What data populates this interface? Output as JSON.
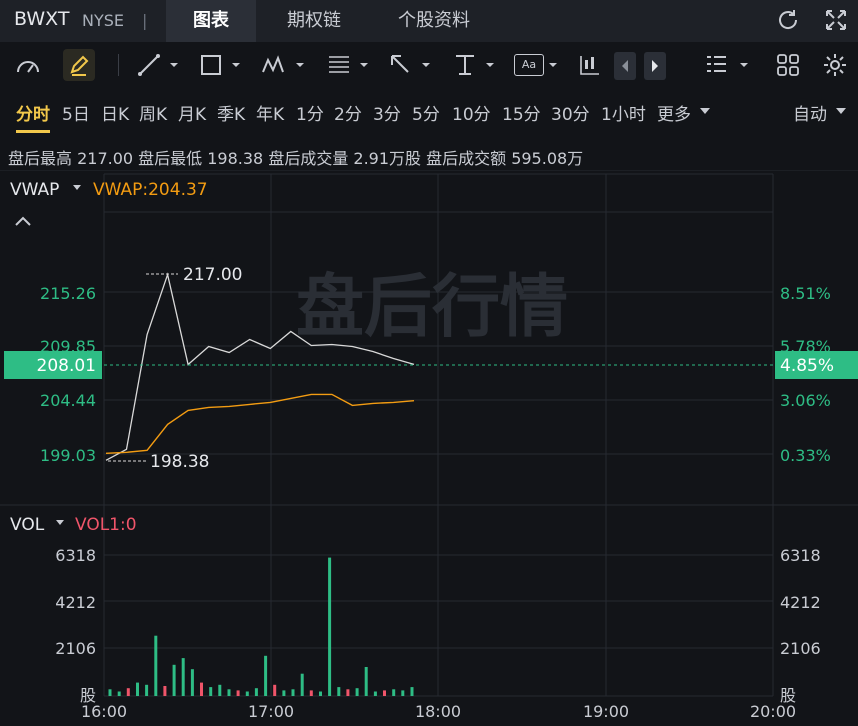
{
  "header": {
    "ticker": "BWXT",
    "exchange": "NYSE",
    "separator": "|",
    "tabs": [
      {
        "label": "图表",
        "active": true
      },
      {
        "label": "期权链",
        "active": false
      },
      {
        "label": "个股资料",
        "active": false
      }
    ],
    "icons": [
      "refresh-icon",
      "fullscreen-icon"
    ]
  },
  "toolbar": {
    "icons": [
      "gauge-icon",
      "pen-icon",
      "line-tool-icon",
      "rectangle-tool-icon",
      "pattern-tool-icon",
      "fibonacci-tool-icon",
      "arrow-tool-icon",
      "price-range-icon",
      "text-annotation-icon",
      "candlestick-icon",
      "prev-arrow-icon",
      "next-arrow-icon",
      "indicator-list-icon",
      "layout-grid-icon",
      "settings-icon"
    ],
    "text_tool_label": "Aa"
  },
  "periods": {
    "items": [
      "分时",
      "5日",
      "日K",
      "周K",
      "月K",
      "季K",
      "年K",
      "1分",
      "2分",
      "3分",
      "5分",
      "10分",
      "15分",
      "30分",
      "1小时",
      "更多"
    ],
    "active": "分时",
    "auto_label": "自动"
  },
  "stats": {
    "text": "盘后最高 217.00 盘后最低 198.38 盘后成交量 2.91万股 盘后成交额 595.08万"
  },
  "price_panel": {
    "indicator_label": "VWAP",
    "indicator_value": "VWAP:204.37",
    "watermark": "盘后行情",
    "high_label": "217.00",
    "low_label": "198.38",
    "current_price": "208.01",
    "current_pct": "4.85%",
    "left_ticks": [
      "215.26",
      "209.85",
      "204.44",
      "199.03"
    ],
    "right_ticks": [
      "8.51%",
      "5.78%",
      "3.06%",
      "0.33%"
    ],
    "colors": {
      "up": "#2ebd85",
      "vwap": "#f39c12",
      "price": "#d9d9d9"
    }
  },
  "volume_panel": {
    "indicator_label": "VOL",
    "indicator_value": "VOL1:0",
    "ticks": [
      "6318",
      "4212",
      "2106",
      "股"
    ],
    "colors": {
      "up": "#2ebd85",
      "down": "#f0556a"
    }
  },
  "time_axis": [
    "16:00",
    "17:00",
    "18:00",
    "19:00",
    "20:00"
  ],
  "chart_data": {
    "type": "line",
    "x_range": [
      "16:00",
      "20:00"
    ],
    "series": [
      {
        "name": "VWAP",
        "values": [
          199.1,
          199.2,
          199.4,
          202.0,
          203.4,
          203.7,
          203.8,
          204.0,
          204.2,
          204.6,
          205.0,
          205.0,
          203.9,
          204.1,
          204.2,
          204.37
        ]
      },
      {
        "name": "",
        "values": [
          198.4,
          199.5,
          211.0,
          217.0,
          208.0,
          209.8,
          209.2,
          210.5,
          209.6,
          211.3,
          209.9,
          210.0,
          209.8,
          209.3,
          208.6,
          208.01
        ]
      }
    ],
    "volume": {
      "values": [
        300,
        200,
        350,
        600,
        500,
        2700,
        450,
        1400,
        1700,
        1200,
        600,
        400,
        500,
        300,
        250,
        200,
        350,
        1800,
        500,
        250,
        300,
        1000,
        250,
        200,
        6200,
        400,
        300,
        350,
        1300,
        200,
        250,
        300,
        250,
        400
      ],
      "max_tick": 6318
    }
  }
}
